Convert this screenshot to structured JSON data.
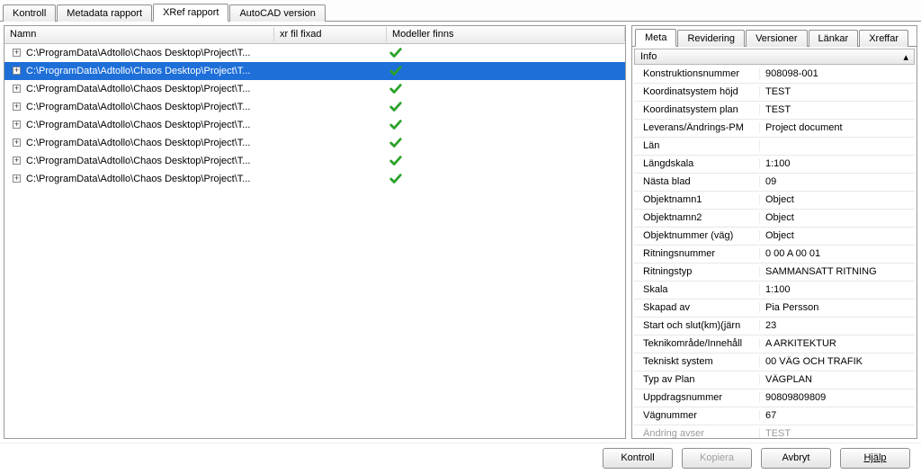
{
  "tabs": {
    "kontroll": "Kontroll",
    "metadata": "Metadata rapport",
    "xref": "XRef rapport",
    "autocad": "AutoCAD version"
  },
  "columns": {
    "name": "Namn",
    "xr": "xr fil fixad",
    "model": "Modeller finns"
  },
  "rows": [
    {
      "path": "C:\\ProgramData\\Adtollo\\Chaos Desktop\\Project\\T...",
      "selected": false
    },
    {
      "path": "C:\\ProgramData\\Adtollo\\Chaos Desktop\\Project\\T...",
      "selected": true
    },
    {
      "path": "C:\\ProgramData\\Adtollo\\Chaos Desktop\\Project\\T...",
      "selected": false
    },
    {
      "path": "C:\\ProgramData\\Adtollo\\Chaos Desktop\\Project\\T...",
      "selected": false
    },
    {
      "path": "C:\\ProgramData\\Adtollo\\Chaos Desktop\\Project\\T...",
      "selected": false
    },
    {
      "path": "C:\\ProgramData\\Adtollo\\Chaos Desktop\\Project\\T...",
      "selected": false
    },
    {
      "path": "C:\\ProgramData\\Adtollo\\Chaos Desktop\\Project\\T...",
      "selected": false
    },
    {
      "path": "C:\\ProgramData\\Adtollo\\Chaos Desktop\\Project\\T...",
      "selected": false
    }
  ],
  "meta_tabs": {
    "meta": "Meta",
    "rev": "Revidering",
    "ver": "Versioner",
    "lank": "Länkar",
    "xref": "Xreffar"
  },
  "info_header": "Info",
  "props": [
    {
      "k": "Konstruktionsnummer",
      "v": "908098-001"
    },
    {
      "k": "Koordinatsystem höjd",
      "v": "TEST"
    },
    {
      "k": "Koordinatsystem plan",
      "v": "TEST"
    },
    {
      "k": "Leverans/Ändrings-PM",
      "v": "Project document"
    },
    {
      "k": "Län",
      "v": ""
    },
    {
      "k": "Längdskala",
      "v": "1:100"
    },
    {
      "k": "Nästa blad",
      "v": "09"
    },
    {
      "k": "Objektnamn1",
      "v": "Object"
    },
    {
      "k": "Objektnamn2",
      "v": "Object"
    },
    {
      "k": "Objektnummer (väg)",
      "v": "Object"
    },
    {
      "k": "Ritningsnummer",
      "v": "0 00 A 00 01"
    },
    {
      "k": "Ritningstyp",
      "v": "SAMMANSATT RITNING"
    },
    {
      "k": "Skala",
      "v": "1:100"
    },
    {
      "k": "Skapad av",
      "v": "Pia Persson"
    },
    {
      "k": "Start och slut(km)(järn",
      "v": "23"
    },
    {
      "k": "Teknikområde/Innehåll",
      "v": "A ARKITEKTUR"
    },
    {
      "k": "Tekniskt system",
      "v": "00 VÄG OCH TRAFIK"
    },
    {
      "k": "Typ av Plan",
      "v": "VÄGPLAN"
    },
    {
      "k": "Uppdragsnummer",
      "v": "90809809809"
    },
    {
      "k": "Vägnummer",
      "v": "67"
    },
    {
      "k": "Ändring avser",
      "v": "TEST",
      "faded": true
    }
  ],
  "footer": {
    "kontroll": "Kontroll",
    "kopiera": "Kopiera",
    "avbryt": "Avbryt",
    "hjalp": "Hjälp"
  }
}
